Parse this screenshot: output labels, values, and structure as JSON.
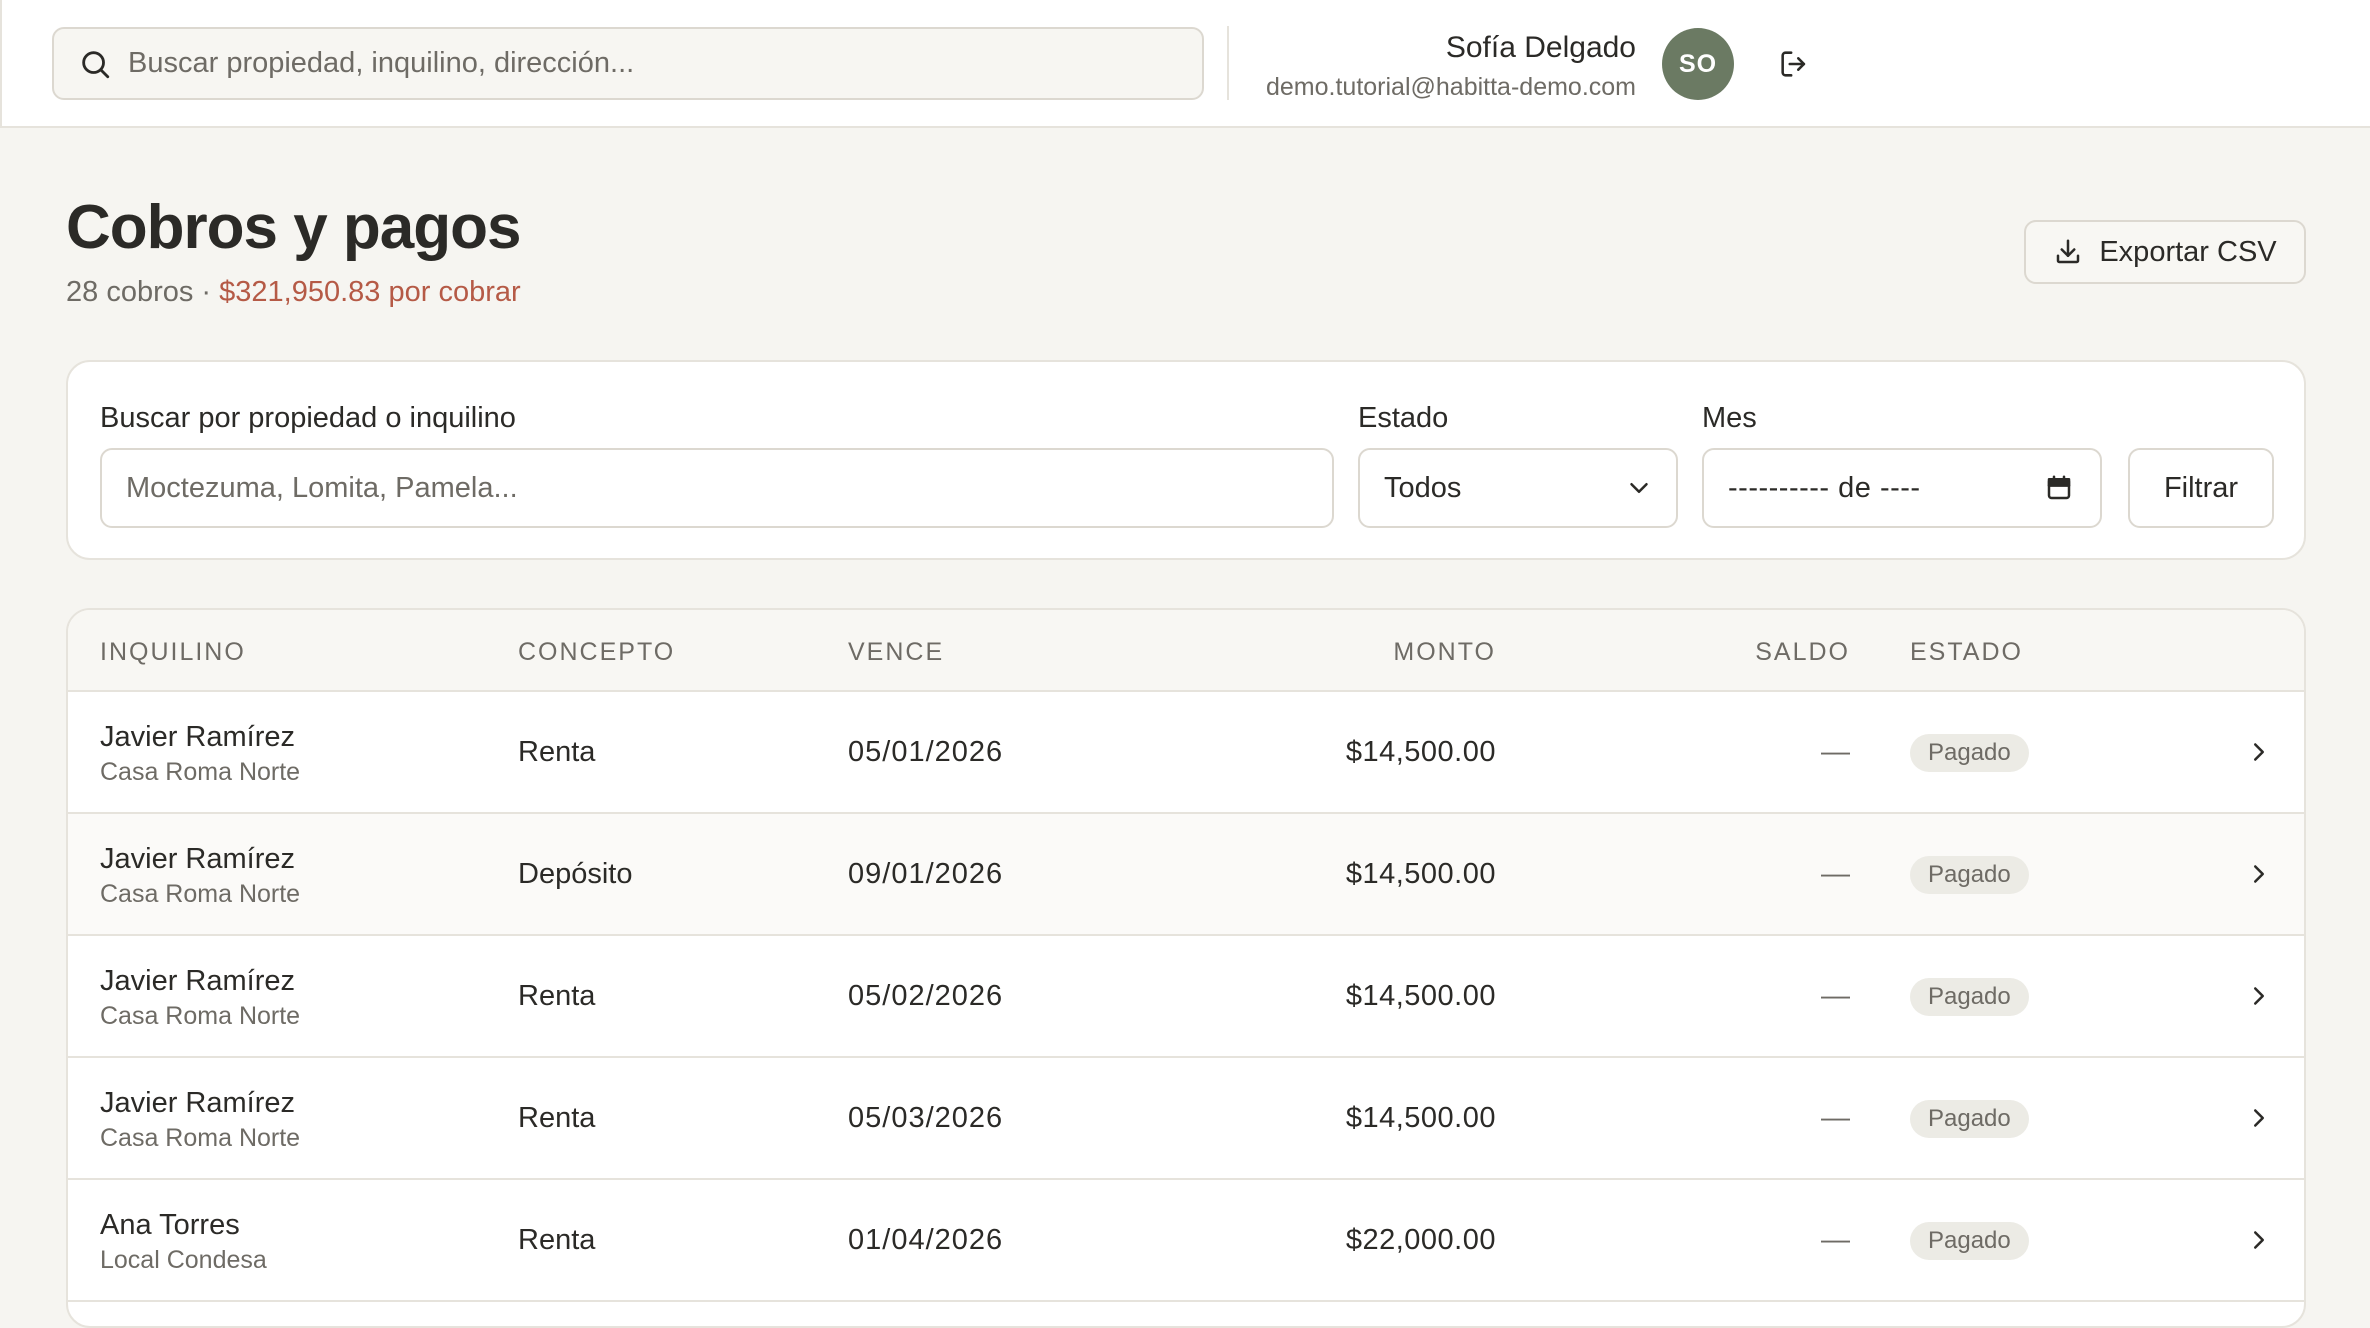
{
  "topbar": {
    "search_placeholder": "Buscar propiedad, inquilino, dirección...",
    "user_name": "Sofía Delgado",
    "user_email": "demo.tutorial@habitta-demo.com",
    "avatar_initials": "SO"
  },
  "page": {
    "title": "Cobros y pagos",
    "count_text": "28 cobros",
    "separator": " · ",
    "due_text": "$321,950.83 por cobrar",
    "export_label": "Exportar CSV"
  },
  "filters": {
    "search_label": "Buscar por propiedad o inquilino",
    "search_placeholder": "Moctezuma, Lomita, Pamela...",
    "status_label": "Estado",
    "status_value": "Todos",
    "month_label": "Mes",
    "month_value": "---------- de ----",
    "filter_button": "Filtrar"
  },
  "table": {
    "columns": {
      "tenant": "INQUILINO",
      "concept": "CONCEPTO",
      "due": "VENCE",
      "amount": "MONTO",
      "balance": "SALDO",
      "status": "ESTADO"
    },
    "rows": [
      {
        "tenant": "Javier Ramírez",
        "property": "Casa Roma Norte",
        "concept": "Renta",
        "due": "05/01/2026",
        "amount": "$14,500.00",
        "balance": "—",
        "status": "Pagado"
      },
      {
        "tenant": "Javier Ramírez",
        "property": "Casa Roma Norte",
        "concept": "Depósito",
        "due": "09/01/2026",
        "amount": "$14,500.00",
        "balance": "—",
        "status": "Pagado"
      },
      {
        "tenant": "Javier Ramírez",
        "property": "Casa Roma Norte",
        "concept": "Renta",
        "due": "05/02/2026",
        "amount": "$14,500.00",
        "balance": "—",
        "status": "Pagado"
      },
      {
        "tenant": "Javier Ramírez",
        "property": "Casa Roma Norte",
        "concept": "Renta",
        "due": "05/03/2026",
        "amount": "$14,500.00",
        "balance": "—",
        "status": "Pagado"
      },
      {
        "tenant": "Ana Torres",
        "property": "Local Condesa",
        "concept": "Renta",
        "due": "01/04/2026",
        "amount": "$22,000.00",
        "balance": "—",
        "status": "Pagado"
      }
    ]
  },
  "icons": {
    "search": "search-icon",
    "logout": "logout-icon",
    "export": "download-icon",
    "select": "chevron-down-icon",
    "calendar": "calendar-icon",
    "row": "chevron-right-icon"
  },
  "colors": {
    "accent_due": "#b55a46",
    "avatar_bg": "#6b7a63",
    "badge_bg": "#ecebe5",
    "page_bg": "#f6f5f1"
  }
}
